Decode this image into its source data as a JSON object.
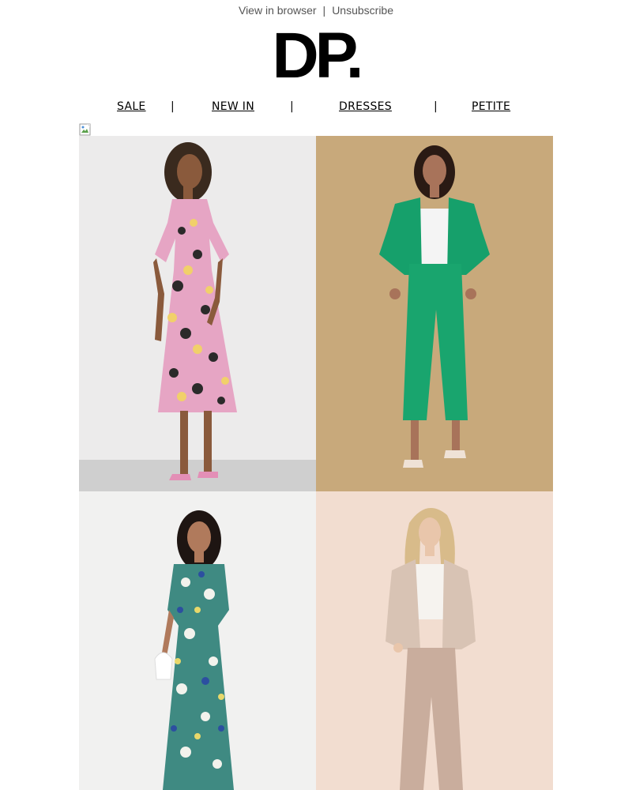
{
  "header": {
    "view_in_browser": "View in browser",
    "separator": "|",
    "unsubscribe": "Unsubscribe"
  },
  "logo": {
    "text": "DP."
  },
  "nav": {
    "items": [
      {
        "label": "SALE"
      },
      {
        "label": "NEW IN"
      },
      {
        "label": "DRESSES"
      },
      {
        "label": "PETITE"
      }
    ],
    "divider": "|"
  },
  "colors": {
    "background": "#ffffff",
    "link": "#555555",
    "nav_text": "#000000",
    "tile1_bg": "#ecebeb",
    "tile2_bg": "#c8a97b",
    "tile3_bg": "#f1f1f0",
    "tile4_bg": "#f2ddd0"
  },
  "products": [
    {
      "name": "floral-flutter-sleeve-midi-dress",
      "icon": "product-photo"
    },
    {
      "name": "green-blazer-and-trouser-suit",
      "icon": "product-photo"
    },
    {
      "name": "blue-floral-wrap-midi-dress",
      "icon": "product-photo"
    },
    {
      "name": "stone-blazer-and-trouser-suit",
      "icon": "product-photo"
    }
  ],
  "broken_image": {
    "icon": "broken-image-icon"
  }
}
